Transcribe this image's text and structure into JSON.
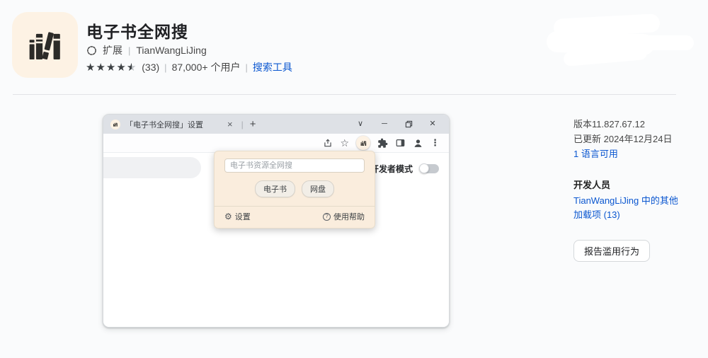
{
  "header": {
    "title": "电子书全网搜",
    "type_label": "扩展",
    "developer": "TianWangLiJing",
    "rating_count": "(33)",
    "users": "87,000+ 个用户",
    "category_link": "搜索工具"
  },
  "browser_window": {
    "tab": {
      "title": "「电子书全网搜」设置"
    },
    "page": {
      "dev_mode_label": "开发者模式"
    },
    "popup": {
      "search_placeholder": "电子书资源全网搜",
      "filter_buttons": [
        "电子书",
        "网盘"
      ],
      "settings_label": "设置",
      "help_label": "使用帮助"
    }
  },
  "info_panel": {
    "version": "版本11.827.67.12",
    "updated": "已更新 2024年12月24日",
    "languages_link": "1 语言可用",
    "developer_heading": "开发人员",
    "developer_link": "TianWangLiJing 中的其他加载项 (13)",
    "report_button": "报告滥用行为"
  },
  "icons": {
    "star_filled": "★",
    "star_outline": "☆",
    "tab_close": "×",
    "new_tab": "+",
    "tab_separator": "|",
    "meta_separator": "|",
    "chevron_down": "∨",
    "minimize": "─",
    "close": "✕",
    "menu_dots": "⋮",
    "gear": "⚙",
    "help": "?"
  },
  "colors": {
    "accent_blue": "#0b57d0",
    "icon_bg": "#fdf2e4",
    "popup_bg": "#faeddd"
  }
}
